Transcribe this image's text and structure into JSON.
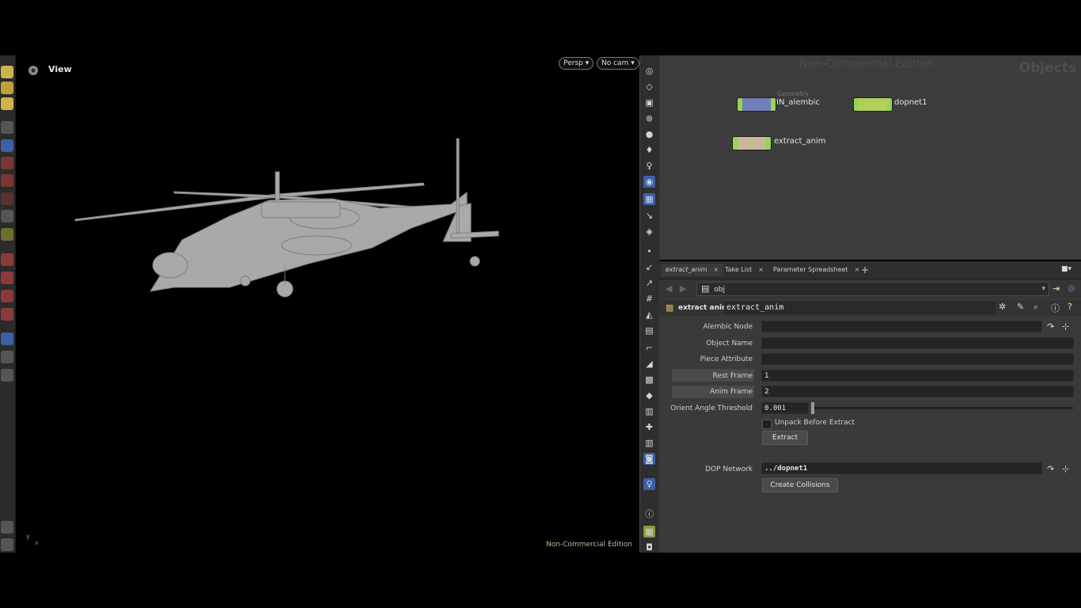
{
  "viewport": {
    "title": "View",
    "persp_button": "Persp ▾",
    "cam_button": "No cam ▾",
    "watermark": "Non-Commercial Edition",
    "axis_y": "y",
    "axis_x": "x"
  },
  "network": {
    "watermark": "Non-Commercial Edition",
    "context": "Objects",
    "nodes": [
      {
        "label": "IN_alembic",
        "type_label": "Geometry"
      },
      {
        "label": "dopnet1"
      },
      {
        "label": "extract_anim"
      }
    ]
  },
  "param_pane": {
    "tabs": [
      {
        "label": "extract_anim"
      },
      {
        "label": "Take List"
      },
      {
        "label": "Parameter Spreadsheet"
      }
    ],
    "add_tab": "+",
    "path": "obj",
    "node_type": "extract anim",
    "node_name": "extract_anim",
    "params": {
      "alembic_node_label": "Alembic Node",
      "alembic_node_value": "",
      "object_name_label": "Object Name",
      "object_name_value": "",
      "piece_attribute_label": "Piece Attribute",
      "piece_attribute_value": "",
      "rest_frame_label": "Rest Frame",
      "rest_frame_value": "1",
      "anim_frame_label": "Anim Frame",
      "anim_frame_value": "2",
      "orient_label": "Orient Angle Threshold",
      "orient_value": "0.001",
      "unpack_label": "Unpack Before Extract",
      "extract_button": "Extract",
      "dop_label": "DOP Network",
      "dop_value": "../dopnet1",
      "create_collisions_button": "Create Collisions"
    }
  }
}
